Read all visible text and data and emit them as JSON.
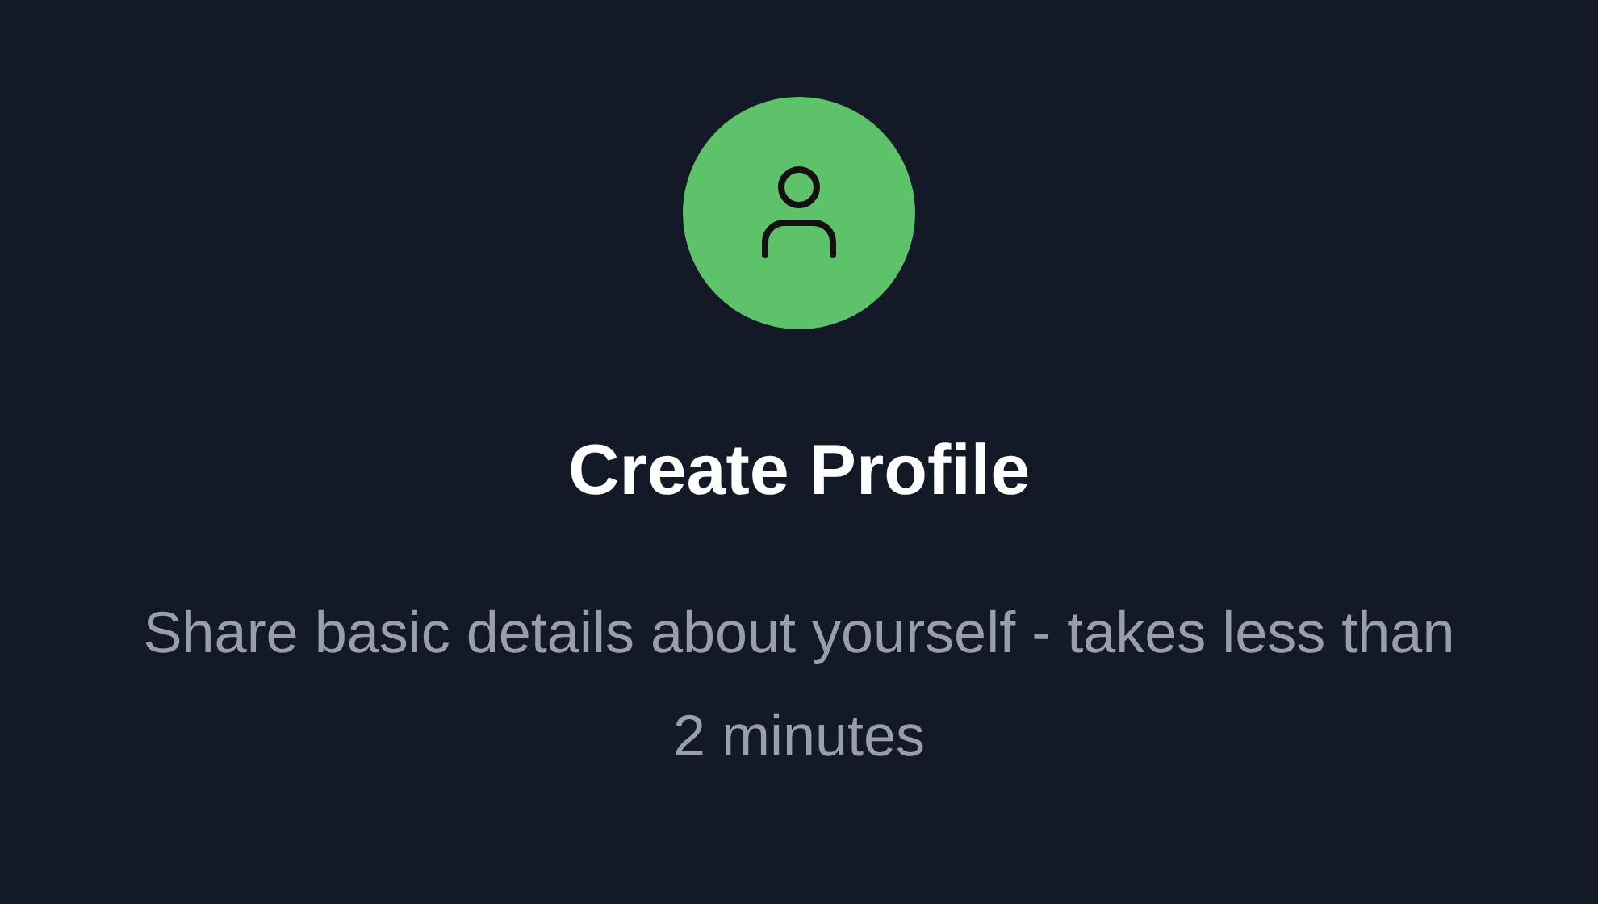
{
  "title": "Create Profile",
  "description": "Share basic details about yourself - takes less than 2 minutes"
}
